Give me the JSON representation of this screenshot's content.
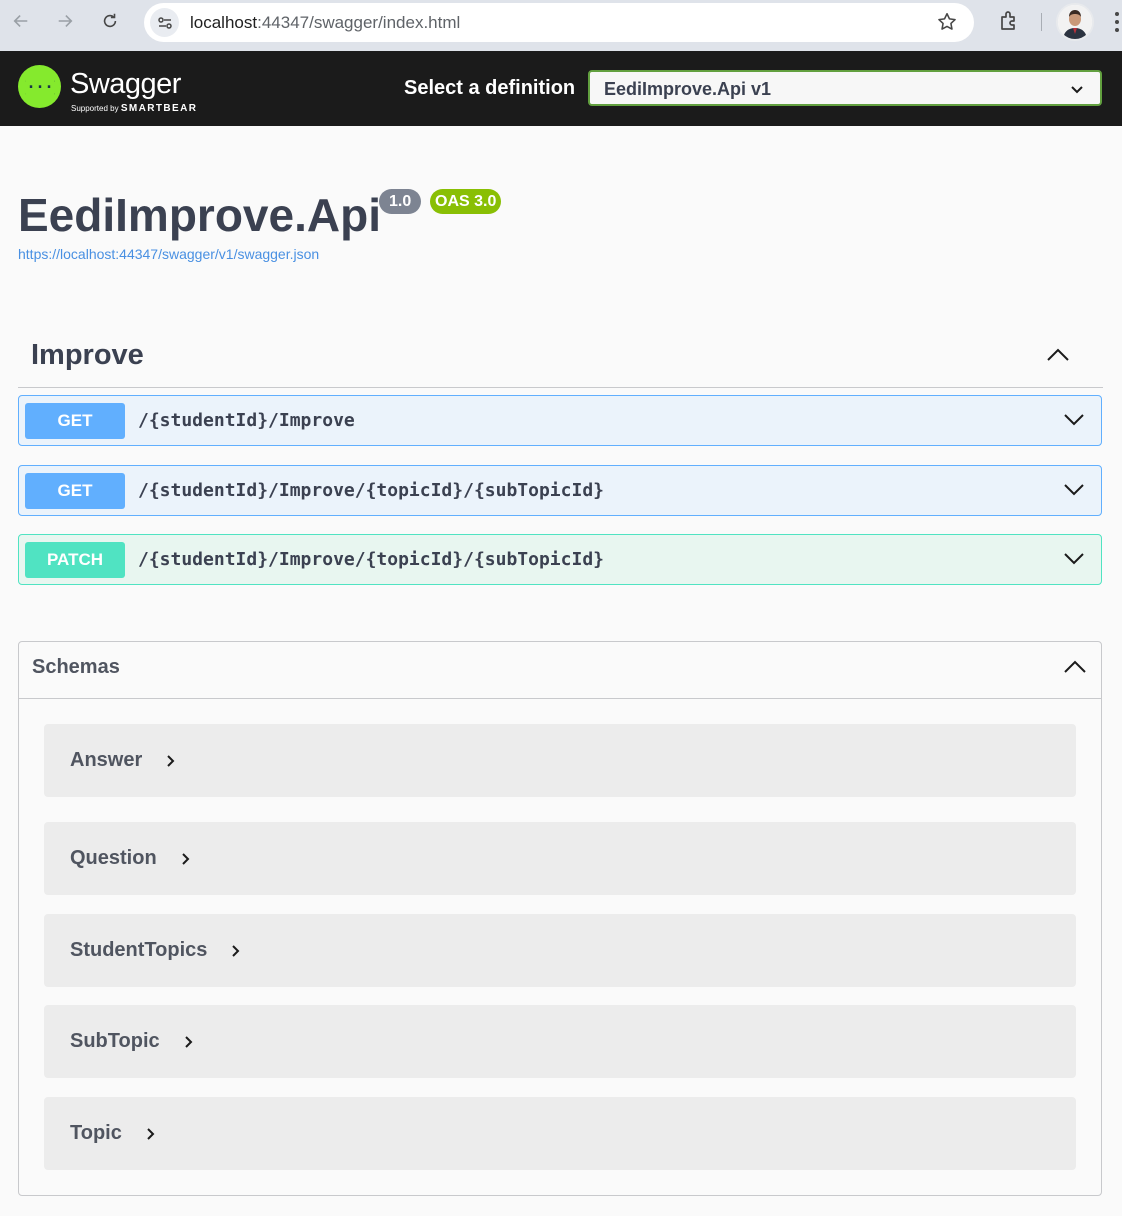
{
  "browser": {
    "url_host": "localhost",
    "url_rest": ":44347/swagger/index.html",
    "icons": [
      "back-icon",
      "forward-icon",
      "reload-icon",
      "site-info-icon",
      "bookmark-star-icon",
      "extensions-icon",
      "profile-avatar",
      "menu-icon"
    ]
  },
  "topbar": {
    "logo_text": "Swagger",
    "logo_supported": "Supported by",
    "logo_brand": "SMARTBEAR",
    "select_label": "Select a definition",
    "select_value": "EediImprove.Api v1"
  },
  "info": {
    "title": "EediImprove.Api",
    "version": "1.0",
    "oas": "OAS 3.0",
    "spec_url": "https://localhost:44347/swagger/v1/swagger.json"
  },
  "tag": {
    "name": "Improve",
    "operations": [
      {
        "method": "GET",
        "path": "/{studentId}/Improve"
      },
      {
        "method": "GET",
        "path": "/{studentId}/Improve/{topicId}/{subTopicId}"
      },
      {
        "method": "PATCH",
        "path": "/{studentId}/Improve/{topicId}/{subTopicId}"
      }
    ]
  },
  "schemas": {
    "title": "Schemas",
    "models": [
      "Answer",
      "Question",
      "StudentTopics",
      "SubTopic",
      "Topic"
    ]
  },
  "colors": {
    "get": "#61affe",
    "patch": "#50e3c2",
    "swagger_green": "#85ea2d",
    "oas_badge": "#89bf04"
  }
}
